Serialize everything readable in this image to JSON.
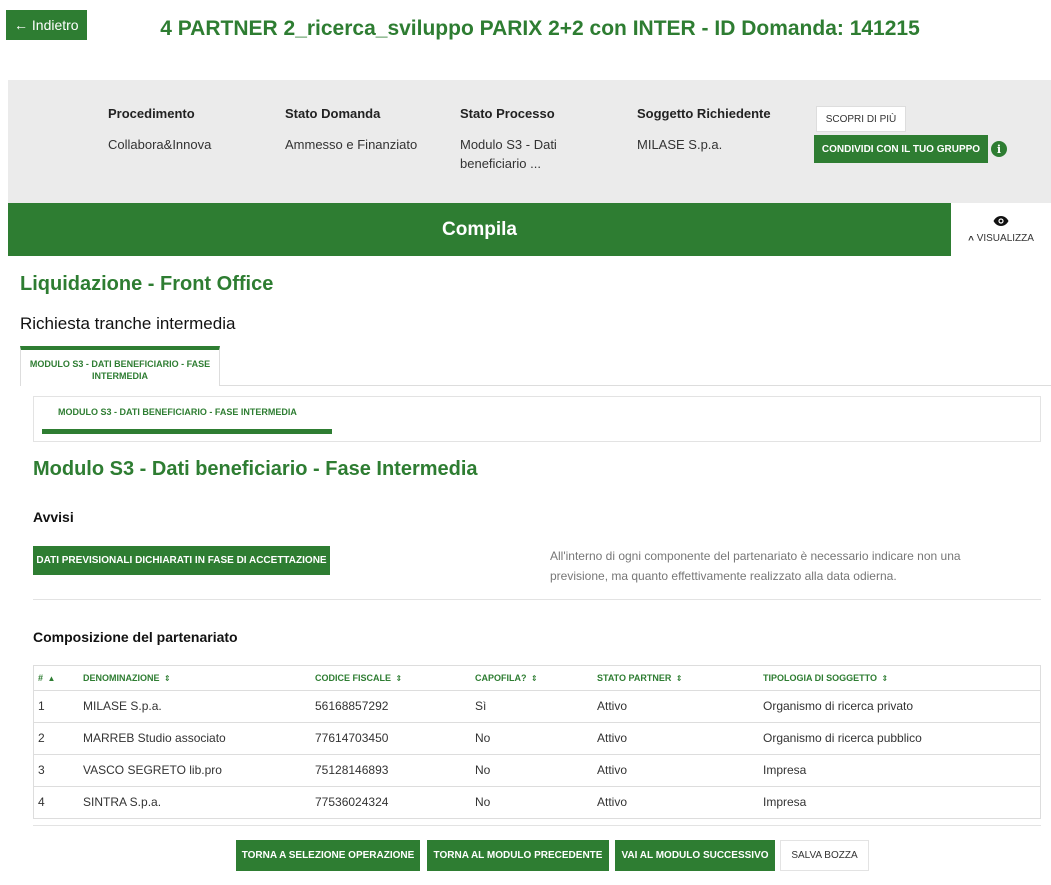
{
  "header": {
    "back_label": "← Indietro",
    "title": "4 PARTNER 2_ricerca_sviluppo PARIX 2+2 con INTER - ID Domanda: 141215"
  },
  "info": {
    "procedimento": {
      "label": "Procedimento",
      "value": "Collabora&Innova"
    },
    "stato_domanda": {
      "label": "Stato Domanda",
      "value": "Ammesso e Finanziato"
    },
    "stato_processo": {
      "label": "Stato Processo",
      "value": "Modulo S3 - Dati beneficiario ..."
    },
    "soggetto": {
      "label": "Soggetto Richiedente",
      "value": "MILASE S.p.a."
    },
    "scopri_label": "SCOPRI DI PIÙ",
    "condividi_label": "CONDIVIDI CON IL TUO GRUPPO",
    "info_icon": "i"
  },
  "compila": {
    "label": "Compila",
    "visualizza_label": "VISUALIZZA",
    "chevron": "^"
  },
  "section": {
    "liquidazione": "Liquidazione - Front Office",
    "richiesta": "Richiesta tranche intermedia",
    "tab_label": "MODULO S3 - DATI BENEFICIARIO - FASE INTERMEDIA",
    "subtab_label": "MODULO S3 - DATI BENEFICIARIO - FASE INTERMEDIA",
    "modulo_title": "Modulo S3 - Dati beneficiario - Fase Intermedia",
    "avvisi": "Avvisi",
    "dati_button": "DATI PREVISIONALI DICHIARATI IN FASE DI ACCETTAZIONE",
    "notice": "All'interno di ogni componente del partenariato è necessario indicare non una previsione, ma quanto effettivamente realizzato alla data odierna.",
    "composizione": "Composizione del partenariato"
  },
  "table": {
    "headers": [
      "#",
      "DENOMINAZIONE",
      "CODICE FISCALE",
      "CAPOFILA?",
      "STATO PARTNER",
      "TIPOLOGIA DI SOGGETTO"
    ],
    "rows": [
      [
        "1",
        "MILASE S.p.a.",
        "56168857292",
        "Sì",
        "Attivo",
        "Organismo di ricerca privato"
      ],
      [
        "2",
        "MARREB Studio associato",
        "77614703450",
        "No",
        "Attivo",
        "Organismo di ricerca pubblico"
      ],
      [
        "3",
        "VASCO SEGRETO lib.pro",
        "75128146893",
        "No",
        "Attivo",
        "Impresa"
      ],
      [
        "4",
        "SINTRA S.p.a.",
        "77536024324",
        "No",
        "Attivo",
        "Impresa"
      ]
    ]
  },
  "footer": {
    "torna_selezione": "TORNA A SELEZIONE OPERAZIONE",
    "torna_precedente": "TORNA AL MODULO PRECEDENTE",
    "vai_successivo": "VAI AL MODULO SUCCESSIVO",
    "salva_bozza": "SALVA BOZZA"
  },
  "colors": {
    "primary": "#2e7d32",
    "info_bg": "#ebebeb"
  }
}
